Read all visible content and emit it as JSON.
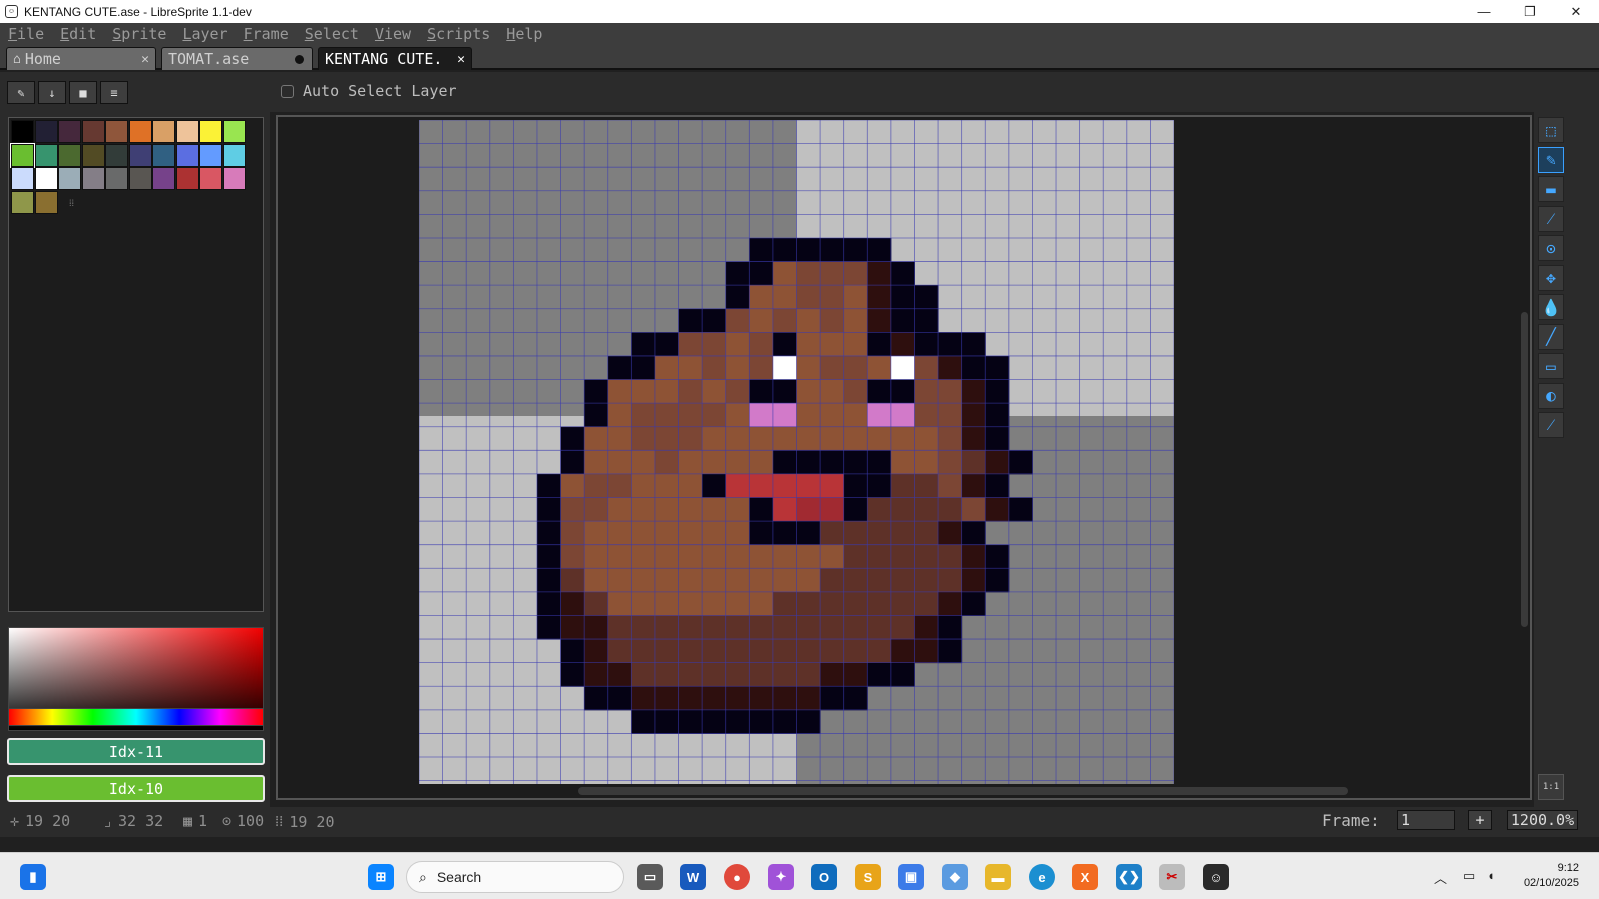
{
  "window": {
    "title": "KENTANG CUTE.ase - LibreSprite 1.1-dev",
    "minimize": "—",
    "maximize": "❐",
    "close": "✕"
  },
  "menu": [
    "File",
    "Edit",
    "Sprite",
    "Layer",
    "Frame",
    "Select",
    "View",
    "Scripts",
    "Help"
  ],
  "tabs": [
    {
      "label": "Home",
      "icon": "home-icon",
      "close": "✕"
    },
    {
      "label": "TOMAT.ase",
      "modified": true
    },
    {
      "label": "KENTANG CUTE.",
      "close": "✕",
      "active": true
    }
  ],
  "context_bar": {
    "auto_select_label": "Auto Select Layer",
    "auto_select_checked": false
  },
  "palette": {
    "colors": [
      "#000000",
      "#222034",
      "#45283c",
      "#663931",
      "#8f563b",
      "#df7126",
      "#d9a066",
      "#eec39a",
      "#fbf236",
      "#99e550",
      "#6abe30",
      "#37946e",
      "#4b692f",
      "#524b24",
      "#323c39",
      "#3f3f74",
      "#306082",
      "#5b6ee1",
      "#639bff",
      "#5fcde4",
      "#cbdbfc",
      "#ffffff",
      "#9badb7",
      "#847e87",
      "#696a6a",
      "#595652",
      "#76428a",
      "#ac3232",
      "#d95763",
      "#d77bba",
      "#8f974a",
      "#8a6f30"
    ],
    "selected_index": 10
  },
  "colors": {
    "foreground_label": "Idx-11",
    "foreground_hex": "#37946e",
    "background_label": "Idx-10",
    "background_hex": "#6abe30"
  },
  "tools": [
    "rectangle-marquee-icon",
    "pencil-icon",
    "eraser-icon",
    "eyedropper-icon",
    "zoom-icon",
    "move-icon",
    "paint-bucket-icon",
    "line-icon",
    "rectangle-icon",
    "contour-icon",
    "blur-icon"
  ],
  "tool_ratio_label": "1:1",
  "status": {
    "cursor": "19 20",
    "size": "32 32",
    "frames": "1",
    "zoom_pct": "100",
    "grid": "19 20",
    "frame_label": "Frame:",
    "frame_value": "1",
    "frame_add": "+",
    "zoom_value": "1200.0%"
  },
  "sprite": {
    "legend": {
      "B": "#050214",
      "D": "#2e0f0e",
      "M": "#5e3128",
      "R": "#7c4634",
      "L": "#8e5335",
      "W": "#ffffff",
      "P": "#d27ac9",
      "C": "#b93437",
      "X": "#a12a31"
    },
    "rows": [
      "",
      "",
      "",
      "",
      "",
      ".........BBBBBB",
      "........BBLRRRDB",
      "........BLLRRLDBB",
      "......BBRLRLRLDBB",
      "....BBRRLRBLLLBDBBB",
      "...BBLLRLRWLRRLWRDBB",
      "..BLLLRLRBBLLRBBRRDB",
      "..BLRRRRLPPLLLPPRRDB",
      ".BLLRRRLLLLLLLLLLRDB",
      ".BLLLRLLLLBBBBBLLRMDB",
      "BLRRLLLBCCCCCBBMMRDB",
      "BRRLLLLLLBCXXBMMMMRDB",
      "BRLLLLLLLBBBMMMMMDB",
      "BRLLLLLLLLLLLMMMMMDB",
      "BMLLLLLLLLLLMMMMMMDB",
      "BDMLLLLLLLMMMMMMMDB",
      "BDDMMMMMMMMMMMMMDB",
      ".BDMMMMMMMMMMMMDDB",
      ".BDDMMMMMMMMDDBB",
      "..BBDDDDDDDDBB",
      "....BBBBBBBB",
      "",
      "",
      "",
      "",
      "",
      ""
    ],
    "offset": [
      5,
      0
    ]
  }
}
